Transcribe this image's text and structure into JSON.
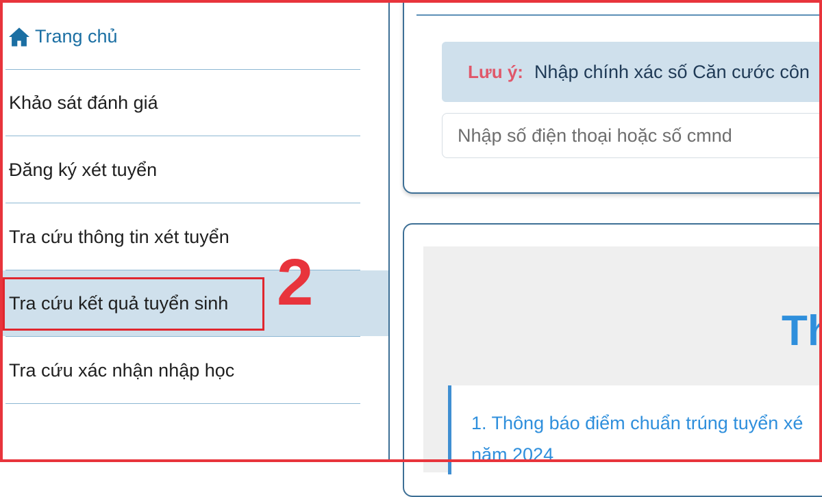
{
  "sidebar": {
    "home": {
      "label": "Trang chủ",
      "icon": "home-icon"
    },
    "items": [
      {
        "label": "Khảo sát đánh giá"
      },
      {
        "label": "Đăng ký xét tuyển"
      },
      {
        "label": "Tra cứu thông tin xét tuyển"
      },
      {
        "label": "Tra cứu kết quả tuyển sinh",
        "active": true
      },
      {
        "label": "Tra cứu xác nhận nhập học"
      }
    ]
  },
  "annotation": {
    "step_number": "2",
    "color": "#e8343c"
  },
  "main": {
    "notice": {
      "label": "Lưu ý:",
      "text": "Nhập chính xác số Căn cước côn"
    },
    "search": {
      "placeholder": "Nhập số điện thoại hoặc số cmnd"
    },
    "panel": {
      "heading": "Th",
      "announcement_line1": "1. Thông báo điểm chuẩn trúng tuyển xé",
      "announcement_line2": "năm 2024"
    }
  },
  "colors": {
    "accent": "#2f8fdc",
    "active_bg": "#cfe0ec",
    "highlight": "#e0262e",
    "text": "#1f1f1f"
  }
}
